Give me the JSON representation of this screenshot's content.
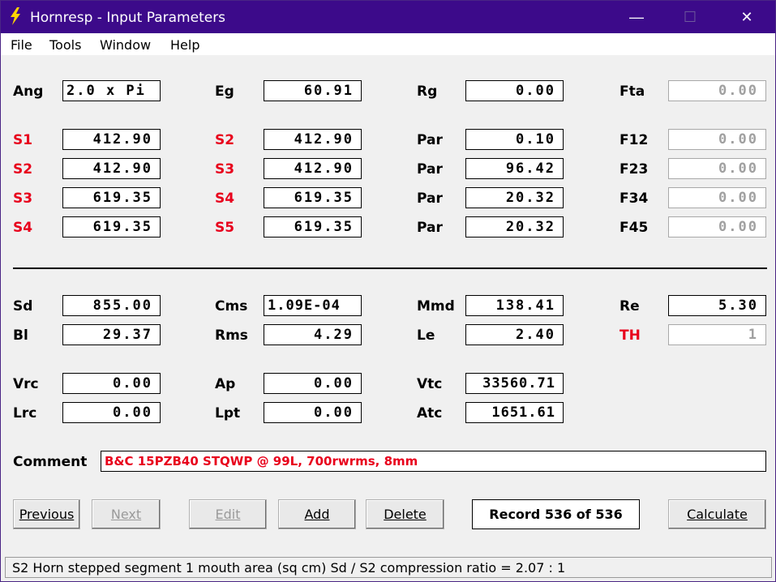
{
  "window": {
    "title": "Hornresp - Input Parameters",
    "minimize_glyph": "—",
    "maximize_glyph": "☐",
    "close_glyph": "✕"
  },
  "menu": [
    "File",
    "Tools",
    "Window",
    "Help"
  ],
  "top": {
    "ang": {
      "label": "Ang",
      "value": "2.0 x Pi"
    },
    "eg": {
      "label": "Eg",
      "value": "60.91"
    },
    "rg": {
      "label": "Rg",
      "value": "0.00"
    },
    "fta": {
      "label": "Fta",
      "value": "0.00"
    }
  },
  "segments": [
    {
      "a_label": "S1",
      "a_value": "412.90",
      "b_label": "S2",
      "b_value": "412.90",
      "c_label": "Par",
      "c_value": "0.10",
      "d_label": "F12",
      "d_value": "0.00"
    },
    {
      "a_label": "S2",
      "a_value": "412.90",
      "b_label": "S3",
      "b_value": "412.90",
      "c_label": "Par",
      "c_value": "96.42",
      "d_label": "F23",
      "d_value": "0.00"
    },
    {
      "a_label": "S3",
      "a_value": "619.35",
      "b_label": "S4",
      "b_value": "619.35",
      "c_label": "Par",
      "c_value": "20.32",
      "d_label": "F34",
      "d_value": "0.00"
    },
    {
      "a_label": "S4",
      "a_value": "619.35",
      "b_label": "S5",
      "b_value": "619.35",
      "c_label": "Par",
      "c_value": "20.32",
      "d_label": "F45",
      "d_value": "0.00"
    }
  ],
  "driver": {
    "sd": {
      "label": "Sd",
      "value": "855.00"
    },
    "cms": {
      "label": "Cms",
      "value": "1.09E-04"
    },
    "mmd": {
      "label": "Mmd",
      "value": "138.41"
    },
    "re": {
      "label": "Re",
      "value": "5.30"
    },
    "bl": {
      "label": "Bl",
      "value": "29.37"
    },
    "rms": {
      "label": "Rms",
      "value": "4.29"
    },
    "le": {
      "label": "Le",
      "value": "2.40"
    },
    "th": {
      "label": "TH",
      "value": "1"
    }
  },
  "chambers": {
    "vrc": {
      "label": "Vrc",
      "value": "0.00"
    },
    "ap": {
      "label": "Ap",
      "value": "0.00"
    },
    "vtc": {
      "label": "Vtc",
      "value": "33560.71"
    },
    "lrc": {
      "label": "Lrc",
      "value": "0.00"
    },
    "lpt": {
      "label": "Lpt",
      "value": "0.00"
    },
    "atc": {
      "label": "Atc",
      "value": "1651.61"
    }
  },
  "comment": {
    "label": "Comment",
    "value": "B&C 15PZB40 STQWP @ 99L, 700rwrms, 8mm"
  },
  "buttons": {
    "previous": "Previous",
    "next": "Next",
    "edit": "Edit",
    "add": "Add",
    "delete": "Delete",
    "calculate": "Calculate"
  },
  "record": "Record 536 of 536",
  "status": "S2   Horn stepped segment 1 mouth area  (sq cm)    Sd / S2 compression ratio = 2.07 : 1",
  "colors": {
    "titlebar": "#3c0a8a",
    "red_label": "#e8001c",
    "icon": "#ffd400"
  }
}
